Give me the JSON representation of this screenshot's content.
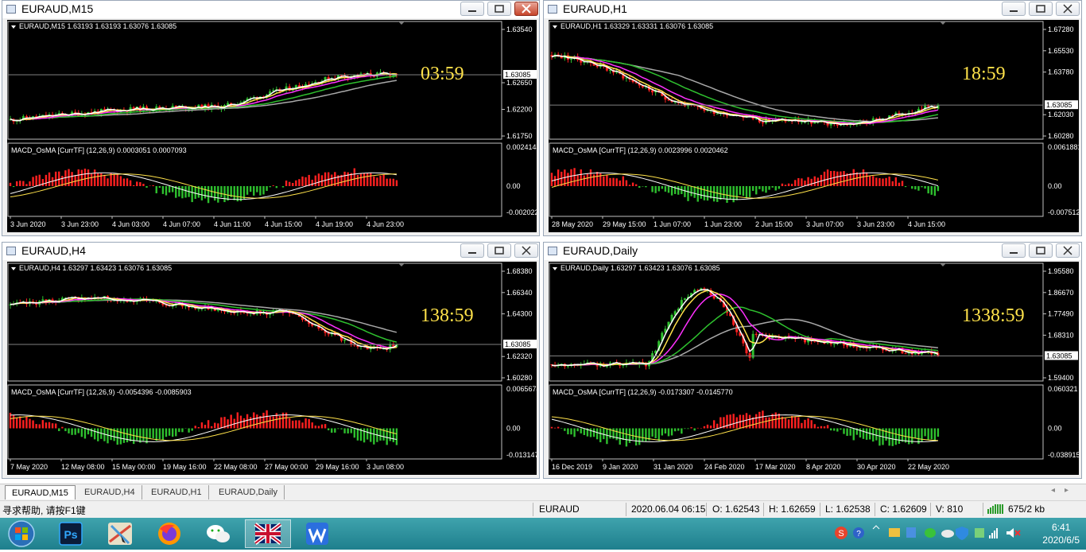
{
  "windows": [
    {
      "id": "m15",
      "title": "EURAUD,M15",
      "info": "EURAUD,M15  1.63193 1.63193 1.63076 1.63085",
      "countdown": "03:59",
      "price_labels": [
        "1.63540",
        "1.63085",
        "1.62650",
        "1.62200",
        "1.61750"
      ],
      "current_price": "1.63085",
      "macd_info": "MACD_OsMA [CurrTF] (12,26,9) 0.0003051 0.0007093",
      "macd_labels": [
        "0.0024143",
        "0.00",
        "-0.0020224"
      ],
      "time_labels": [
        "3 Jun 2020",
        "3 Jun 23:00",
        "4 Jun 03:00",
        "4 Jun 07:00",
        "4 Jun 11:00",
        "4 Jun 15:00",
        "4 Jun 19:00",
        "4 Jun 23:00"
      ]
    },
    {
      "id": "h1",
      "title": "EURAUD,H1",
      "info": "EURAUD,H1  1.63329 1.63331 1.63076 1.63085",
      "countdown": "18:59",
      "price_labels": [
        "1.67280",
        "1.65530",
        "1.63780",
        "1.63085",
        "1.62030",
        "1.60280"
      ],
      "current_price": "1.63085",
      "macd_info": "MACD_OsMA [CurrTF] (12,26,9) 0.0023996 0.0020462",
      "macd_labels": [
        "0.0061881",
        "0.00",
        "-0.0075122"
      ],
      "time_labels": [
        "28 May 2020",
        "29 May 15:00",
        "1 Jun 07:00",
        "1 Jun 23:00",
        "2 Jun 15:00",
        "3 Jun 07:00",
        "3 Jun 23:00",
        "4 Jun 15:00"
      ]
    },
    {
      "id": "h4",
      "title": "EURAUD,H4",
      "info": "EURAUD,H4  1.63297 1.63423 1.63076 1.63085",
      "countdown": "138:59",
      "price_labels": [
        "1.68380",
        "1.66340",
        "1.64300",
        "1.63085",
        "1.62320",
        "1.60280"
      ],
      "current_price": "1.63085",
      "macd_info": "MACD_OsMA [CurrTF] (12,26,9) -0.0054396 -0.0085903",
      "macd_labels": [
        "0.0065674",
        "0.00",
        "-0.013147"
      ],
      "time_labels": [
        "7 May 2020",
        "12 May 08:00",
        "15 May 00:00",
        "19 May 16:00",
        "22 May 08:00",
        "27 May 00:00",
        "29 May 16:00",
        "3 Jun 08:00"
      ]
    },
    {
      "id": "daily",
      "title": "EURAUD,Daily",
      "info": "EURAUD,Daily  1.63297 1.63423 1.63076 1.63085",
      "countdown": "1338:59",
      "price_labels": [
        "1.95580",
        "1.86670",
        "1.77490",
        "1.68310",
        "1.63085",
        "1.59400"
      ],
      "current_price": "1.63085",
      "macd_info": "MACD_OsMA [CurrTF] (12,26,9) -0.0173307 -0.0145770",
      "macd_labels": [
        "0.060321",
        "0.00",
        "-0.038915"
      ],
      "time_labels": [
        "16 Dec 2019",
        "9 Jan 2020",
        "31 Jan 2020",
        "24 Feb 2020",
        "17 Mar 2020",
        "8 Apr 2020",
        "30 Apr 2020",
        "22 May 2020"
      ]
    }
  ],
  "tabs": [
    "EURAUD,M15",
    "EURAUD,H4",
    "EURAUD,H1",
    "EURAUD,Daily"
  ],
  "status": {
    "help": "寻求帮助, 请按F1键",
    "symbol": "EURAUD",
    "datetime": "2020.06.04 06:15",
    "open": "O: 1.62543",
    "high": "H: 1.62659",
    "low": "L: 1.62538",
    "close": "C: 1.62609",
    "volume": "V: 810",
    "traffic": "675/2 kb"
  },
  "taskbar": {
    "apps": [
      "start-orb",
      "photoshop",
      "maps",
      "firefox",
      "wechat",
      "metatrader",
      "wps"
    ],
    "ps_label": "Ps",
    "time": "6:41",
    "date": "2020/6/5"
  },
  "colors": {
    "bull": "#2ec02e",
    "bear": "#ff2020",
    "ma_fast": "#ffffff",
    "ma_mid": "#ffe24a",
    "ma_magenta": "#ff30ff",
    "ma_green": "#2ec02e",
    "ma_slow": "#a8a8a8",
    "countdown": "#ffe24a"
  }
}
